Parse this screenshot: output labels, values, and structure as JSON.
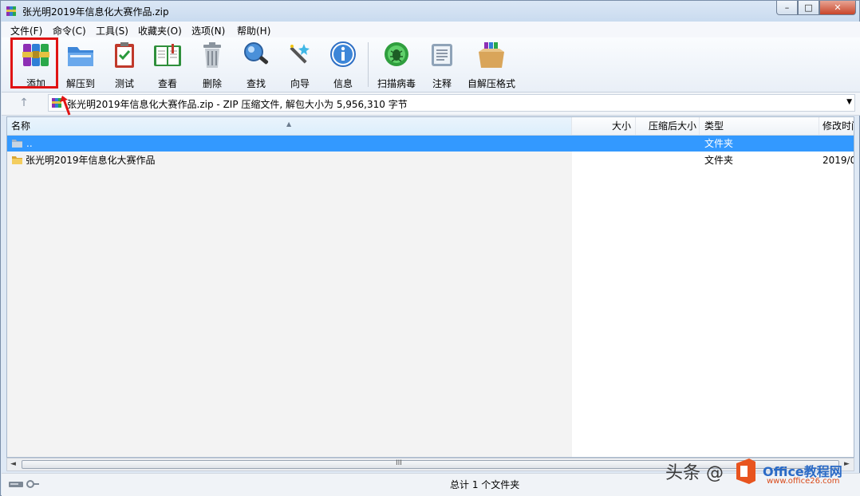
{
  "window": {
    "title": "张光明2019年信息化大赛作品.zip",
    "buttons": {
      "minimize": "–",
      "maximize": "□",
      "close": "✕"
    }
  },
  "menu": [
    "文件(F)",
    "命令(C)",
    "工具(S)",
    "收藏夹(O)",
    "选项(N)",
    "帮助(H)"
  ],
  "toolbar": [
    {
      "label": "添加",
      "icon": "add-archive-icon"
    },
    {
      "label": "解压到",
      "icon": "extract-to-icon"
    },
    {
      "label": "测试",
      "icon": "test-clipboard-icon"
    },
    {
      "label": "查看",
      "icon": "view-book-icon"
    },
    {
      "label": "删除",
      "icon": "trash-icon"
    },
    {
      "label": "查找",
      "icon": "magnifier-icon"
    },
    {
      "label": "向导",
      "icon": "wizard-wand-icon"
    },
    {
      "label": "信息",
      "icon": "info-icon"
    },
    {
      "label": "扫描病毒",
      "icon": "virus-scan-icon"
    },
    {
      "label": "注释",
      "icon": "comment-icon"
    },
    {
      "label": "自解压格式",
      "icon": "sfx-box-icon"
    }
  ],
  "address": {
    "up_label": "↑",
    "text": "张光明2019年信息化大赛作品.zip - ZIP 压缩文件, 解包大小为 5,956,310 字节",
    "dropdown": "▼"
  },
  "columns": [
    "名称",
    "大小",
    "压缩后大小",
    "类型",
    "修改时间"
  ],
  "rows": [
    {
      "name": "..",
      "size": "",
      "packed": "",
      "type": "文件夹",
      "modified": ""
    },
    {
      "name": "张光明2019年信息化大赛作品",
      "size": "",
      "packed": "",
      "type": "文件夹",
      "modified": "2019/0"
    }
  ],
  "scrollbar": {
    "left": "◄",
    "grip": "III",
    "right": "►"
  },
  "status": {
    "text": "总计 1 个文件夹"
  },
  "watermark": {
    "text": "头条 @",
    "site": "Office教程网",
    "url": "www.office26.com"
  },
  "colors": {
    "highlight": "#e01414",
    "selection": "#3399ff"
  }
}
